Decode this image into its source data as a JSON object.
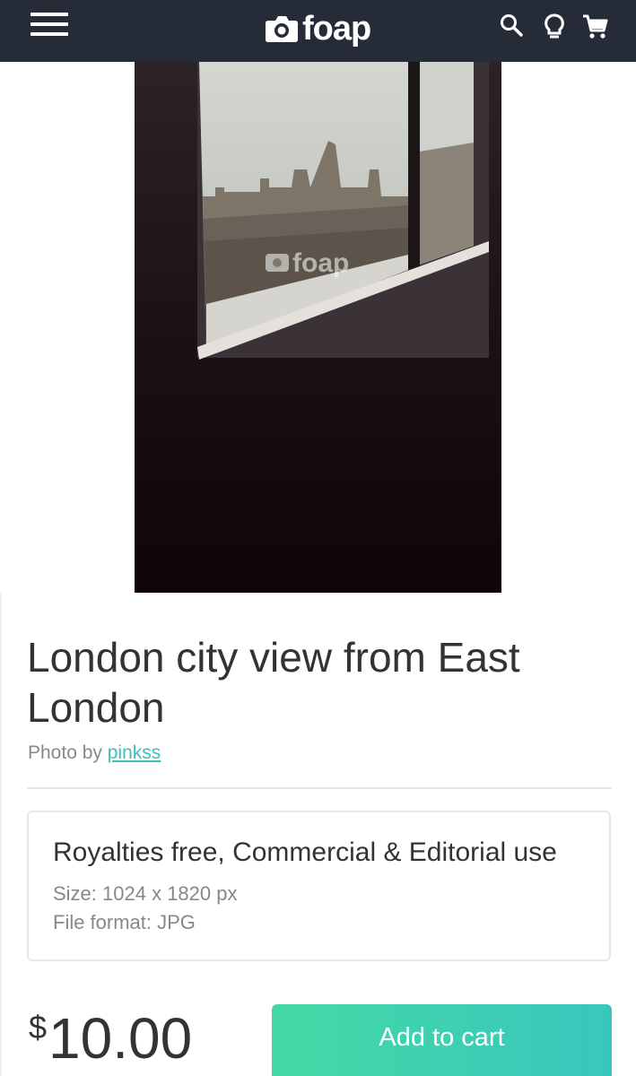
{
  "header": {
    "brand": "foap",
    "icons": [
      "menu-icon",
      "search-icon",
      "lightbulb-icon",
      "cart-icon"
    ]
  },
  "photo": {
    "watermark": "foap"
  },
  "product": {
    "title": "London city view from East London",
    "byline_prefix": "Photo by",
    "author": "pinkss"
  },
  "license": {
    "title": "Royalties free, Commercial & Editorial use",
    "size": "Size: 1024 x 1820 px",
    "format": "File format: JPG"
  },
  "purchase": {
    "currency": "$",
    "amount": "10.00",
    "button_label": "Add to cart"
  },
  "colors": {
    "header_bg": "#262b38",
    "accent_link": "#3bbfbf",
    "button_start": "#44d9a4",
    "button_end": "#37c7bd"
  }
}
